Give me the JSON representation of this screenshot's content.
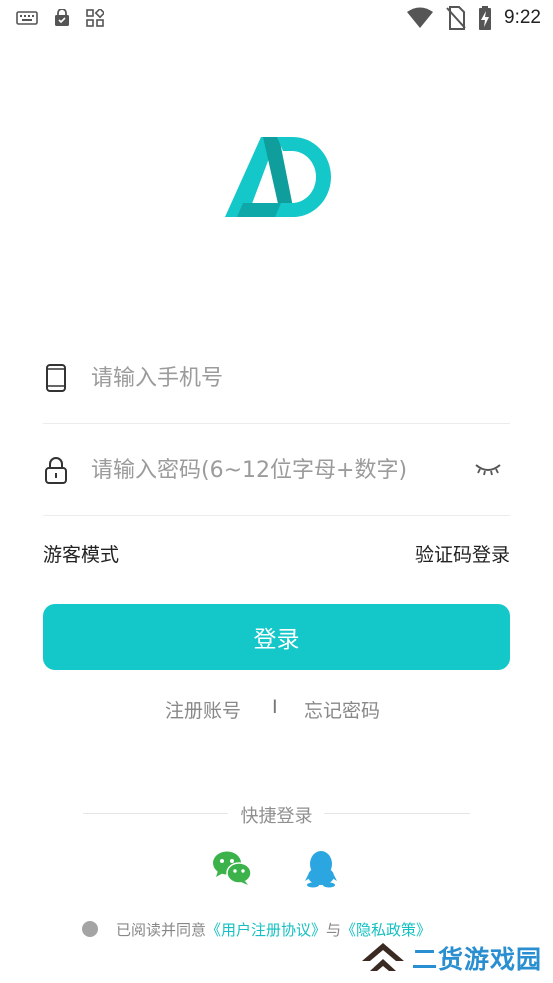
{
  "status_bar": {
    "time": "9:22",
    "icons": [
      "keyboard-icon",
      "lock-bag-icon",
      "apps-grid-icon",
      "wifi-icon",
      "no-sim-icon",
      "battery-charging-icon"
    ]
  },
  "brand": {
    "logo_icon": "ad-logo-icon",
    "colors": {
      "accent": "#14c7c9",
      "logo_dark": "#0f9e9c"
    }
  },
  "login_form": {
    "phone_placeholder": "请输入手机号",
    "password_placeholder": "请输入密码(6~12位字母+数字)",
    "guest_mode": "游客模式",
    "sms_login": "验证码登录",
    "login_button": "登录"
  },
  "aux_links": {
    "register": "注册账号",
    "separator": "I",
    "forgot_password": "忘记密码"
  },
  "quick_login": {
    "title": "快捷登录",
    "providers": [
      "wechat-icon",
      "qq-icon"
    ]
  },
  "agreement": {
    "prefix": "已阅读并同意",
    "user_agreement": "《用户注册协议》",
    "conjunction": "与",
    "privacy_policy": "《隐私政策》"
  },
  "watermark": {
    "text": "二货游戏园"
  }
}
